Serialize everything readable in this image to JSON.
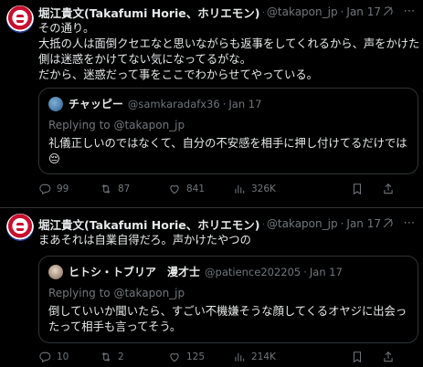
{
  "tweets": [
    {
      "name": "堀江貴文(Takafumi Horie、ホリエモン)",
      "handle": "@takapon_jp",
      "time": "Jan 17",
      "lines": [
        "その通り。",
        "大抵の人は面倒クセエなと思いながらも返事をしてくれるから、声をかけた",
        "側は迷惑をかけてない気になってるがな。",
        "だから、迷惑だって事をここでわからせてやっている。"
      ],
      "quote": {
        "name": "チャッピー",
        "handle": "@samkaradafx36",
        "time": "Jan 17",
        "reply_prefix": "Replying to ",
        "reply_handle": "@takapon_jp",
        "lines": [
          "礼儀正しいのではなくて、自分の不安感を相手に押し付けてるだけでは",
          "😔"
        ]
      },
      "actions": {
        "replies": "99",
        "reposts": "87",
        "likes": "841",
        "views": "326K"
      }
    },
    {
      "name": "堀江貴文(Takafumi Horie、ホリエモン)",
      "handle": "@takapon_jp",
      "time": "Jan 17",
      "lines": [
        "まあそれは自業自得だろ。声かけたやつの"
      ],
      "quote": {
        "name": "ヒトシ・トブリア　漫才士",
        "handle": "@patience202205",
        "time": "Jan 17",
        "reply_prefix": "Replying to ",
        "reply_handle": "@takapon_jp",
        "lines": [
          "倒していいか聞いたら、すごい不機嫌そうな顔してくるオヤジに出会っ",
          "たって相手も言ってそう。"
        ]
      },
      "actions": {
        "replies": "10",
        "reposts": "2",
        "likes": "125",
        "views": "214K"
      }
    }
  ],
  "colors": {
    "background": "#000000",
    "text": "#e7e9ea",
    "muted": "#71767b",
    "border": "#2f3336",
    "verified": "#1d9bf0"
  },
  "icons": [
    "grok-icon",
    "more-icon",
    "reply-icon",
    "repost-icon",
    "like-icon",
    "views-icon",
    "bookmark-icon",
    "share-icon",
    "verified-badge-icon"
  ]
}
